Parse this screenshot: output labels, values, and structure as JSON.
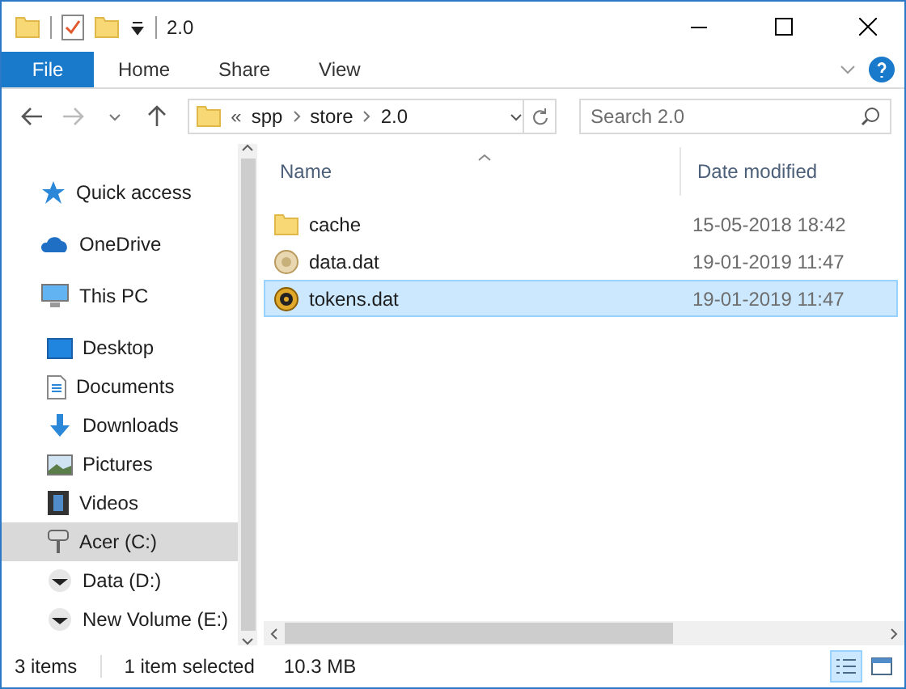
{
  "window": {
    "title": "2.0"
  },
  "ribbon_tabs": [
    {
      "label": "File",
      "kind": "file"
    },
    {
      "label": "Home",
      "kind": "tab"
    },
    {
      "label": "Share",
      "kind": "tab"
    },
    {
      "label": "View",
      "kind": "tab"
    }
  ],
  "address": {
    "overflow": "«",
    "path": [
      "spp",
      "store",
      "2.0"
    ]
  },
  "search": {
    "placeholder": "Search 2.0"
  },
  "nav": [
    {
      "label": "Quick access",
      "kind": "star",
      "selected": false
    },
    {
      "label": "OneDrive",
      "kind": "cloud",
      "selected": false
    },
    {
      "label": "This PC",
      "kind": "pc",
      "selected": false,
      "children": [
        {
          "label": "Desktop",
          "kind": "desktop",
          "selected": false
        },
        {
          "label": "Documents",
          "kind": "document",
          "selected": false
        },
        {
          "label": "Downloads",
          "kind": "download",
          "selected": false
        },
        {
          "label": "Pictures",
          "kind": "picture",
          "selected": false
        },
        {
          "label": "Videos",
          "kind": "film",
          "selected": false
        },
        {
          "label": "Acer (C:)",
          "kind": "drive",
          "selected": true
        },
        {
          "label": "Data (D:)",
          "kind": "disc",
          "selected": false
        },
        {
          "label": "New Volume (E:)",
          "kind": "disc",
          "selected": false
        }
      ]
    }
  ],
  "columns": [
    {
      "label": "Name",
      "sorted": true
    },
    {
      "label": "Date modified",
      "sorted": false
    }
  ],
  "files": [
    {
      "name": "cache",
      "kind": "folder",
      "date": "15-05-2018 18:42",
      "selected": false
    },
    {
      "name": "data.dat",
      "kind": "dat",
      "date": "19-01-2019 11:47",
      "selected": false
    },
    {
      "name": "tokens.dat",
      "kind": "dat-dark",
      "date": "19-01-2019 11:47",
      "selected": true
    }
  ],
  "status_bar": {
    "count": "3 items",
    "selection": "1 item selected",
    "size": "10.3 MB"
  },
  "views": [
    {
      "kind": "details",
      "selected": true
    },
    {
      "kind": "tiles",
      "selected": false
    }
  ]
}
